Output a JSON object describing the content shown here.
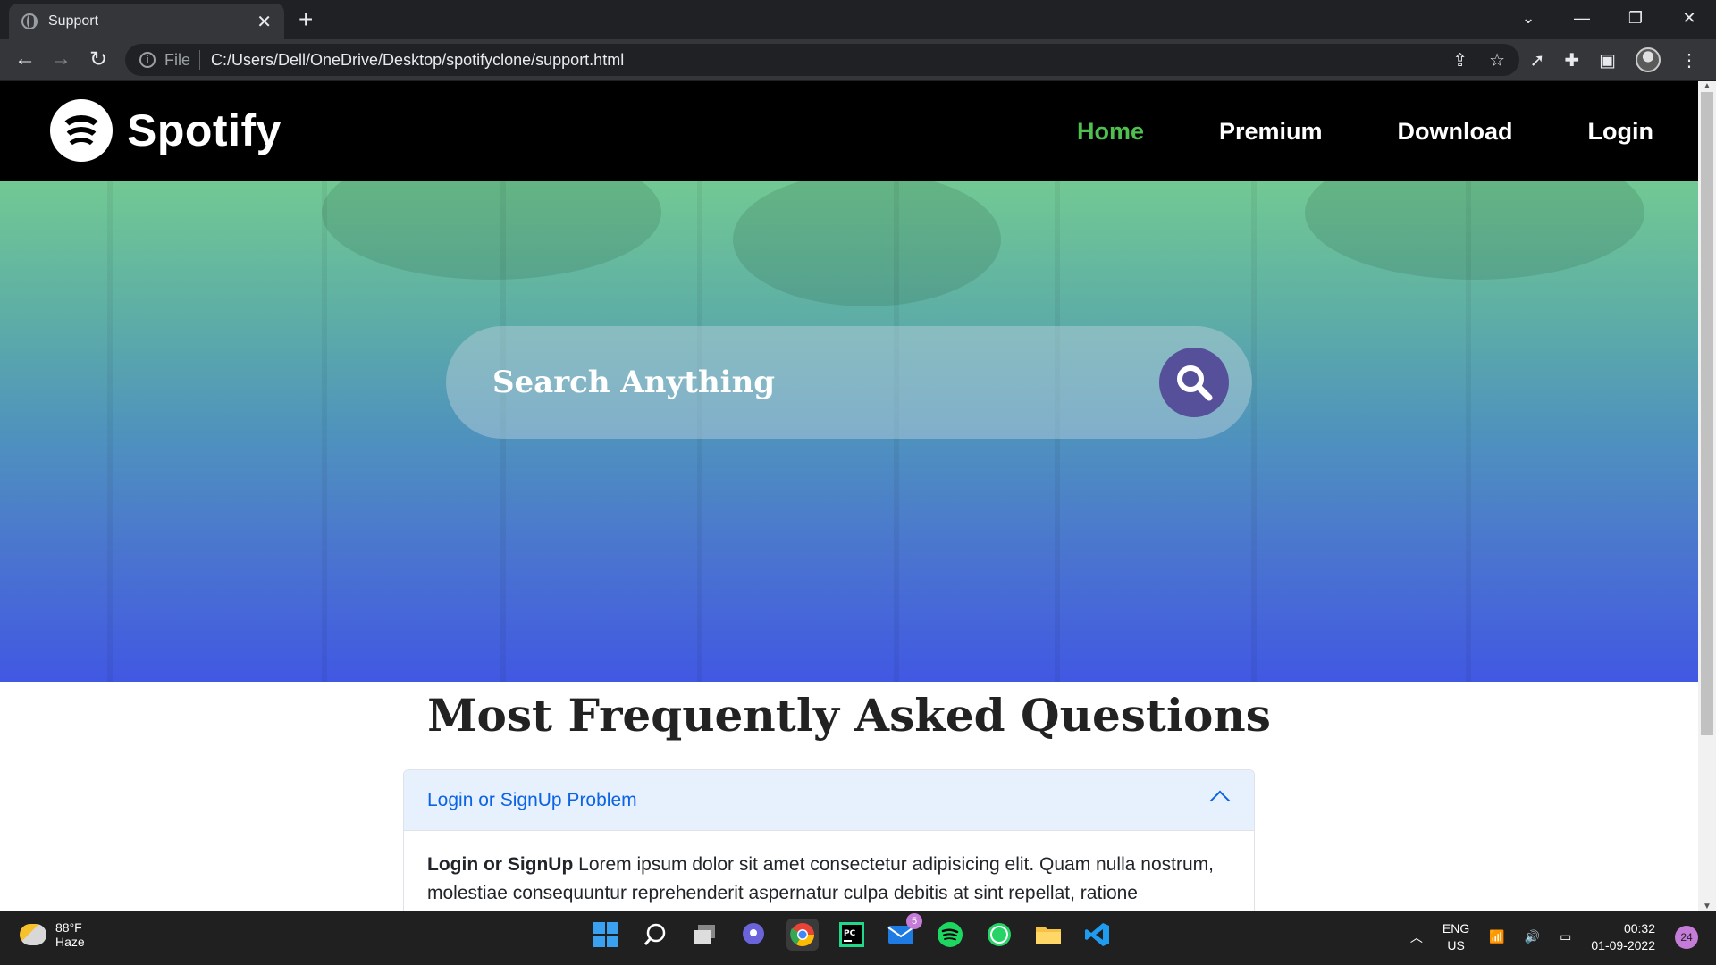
{
  "browser": {
    "tab_title": "Support",
    "tab_close": "✕",
    "new_tab": "+",
    "file_label": "File",
    "url": "C:/Users/Dell/OneDrive/Desktop/spotifyclone/support.html",
    "window_controls": [
      "⌄",
      "—",
      "❐",
      "✕"
    ]
  },
  "site": {
    "logo_text": "Spotify",
    "nav": [
      {
        "label": "Home",
        "active": true
      },
      {
        "label": "Premium",
        "active": false
      },
      {
        "label": "Download",
        "active": false
      },
      {
        "label": "Login",
        "active": false
      }
    ],
    "search_placeholder": "Search Anything",
    "faq_title": "Most Frequently Asked Questions",
    "accordion": {
      "header": "Login or SignUp Problem",
      "body_bold": "Login or SignUp",
      "body_text": " Lorem ipsum dolor sit amet consectetur adipisicing elit. Quam nulla nostrum, molestiae consequuntur reprehenderit aspernatur culpa debitis at sint repellat, ratione accusamus."
    }
  },
  "taskbar": {
    "weather_temp": "88°F",
    "weather_desc": "Haze",
    "mail_badge": "5",
    "lang_top": "ENG",
    "lang_bottom": "US",
    "time": "00:32",
    "date": "01-09-2022",
    "notification_count": "24"
  },
  "colors": {
    "nav_active": "#4fc04f",
    "search_button": "#56509a",
    "accordion_accent": "#0c63e4"
  }
}
